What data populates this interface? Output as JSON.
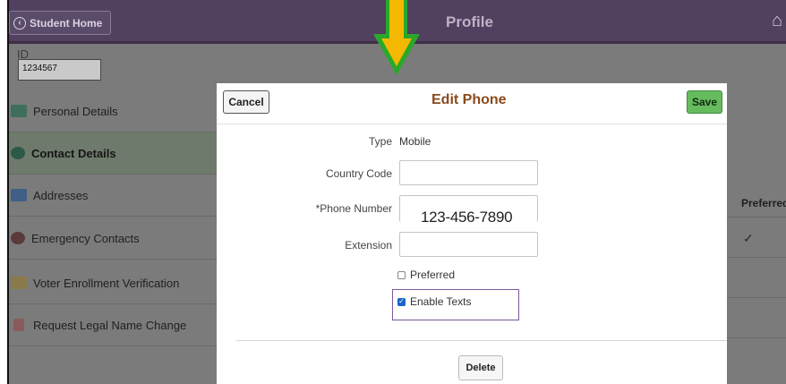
{
  "header": {
    "back_label": "Student Home",
    "title": "Profile"
  },
  "id_block": {
    "label": "ID",
    "value": "1234567"
  },
  "sidebar": {
    "items": [
      {
        "label": "Personal Details",
        "icon": "id-card-icon"
      },
      {
        "label": "Contact Details",
        "icon": "phone-at-icon"
      },
      {
        "label": "Addresses",
        "icon": "envelope-icon"
      },
      {
        "label": "Emergency Contacts",
        "icon": "phone-cross-icon"
      },
      {
        "label": "Voter Enrollment Verification",
        "icon": "voter-icon"
      },
      {
        "label": "Request Legal Name Change",
        "icon": "document-person-icon"
      }
    ],
    "active_index": 1
  },
  "background_table": {
    "preferred_header": "Preferred",
    "preferred_check": "✓"
  },
  "modal": {
    "title": "Edit Phone",
    "cancel_label": "Cancel",
    "save_label": "Save",
    "type_label": "Type",
    "type_value": "Mobile",
    "country_code_label": "Country Code",
    "country_code_value": "",
    "phone_label": "*Phone Number",
    "phone_value": "123-456-7890",
    "extension_label": "Extension",
    "extension_value": "",
    "preferred_label": "Preferred",
    "preferred_checked": false,
    "enable_texts_label": "Enable Texts",
    "enable_texts_checked": true,
    "delete_label": "Delete"
  },
  "colors": {
    "header_bg": "#514060",
    "arrow_fill": "#f5b800",
    "arrow_outline": "#2aa82a",
    "save_green": "#66bb5f",
    "title_brown": "#8a4a1d"
  }
}
